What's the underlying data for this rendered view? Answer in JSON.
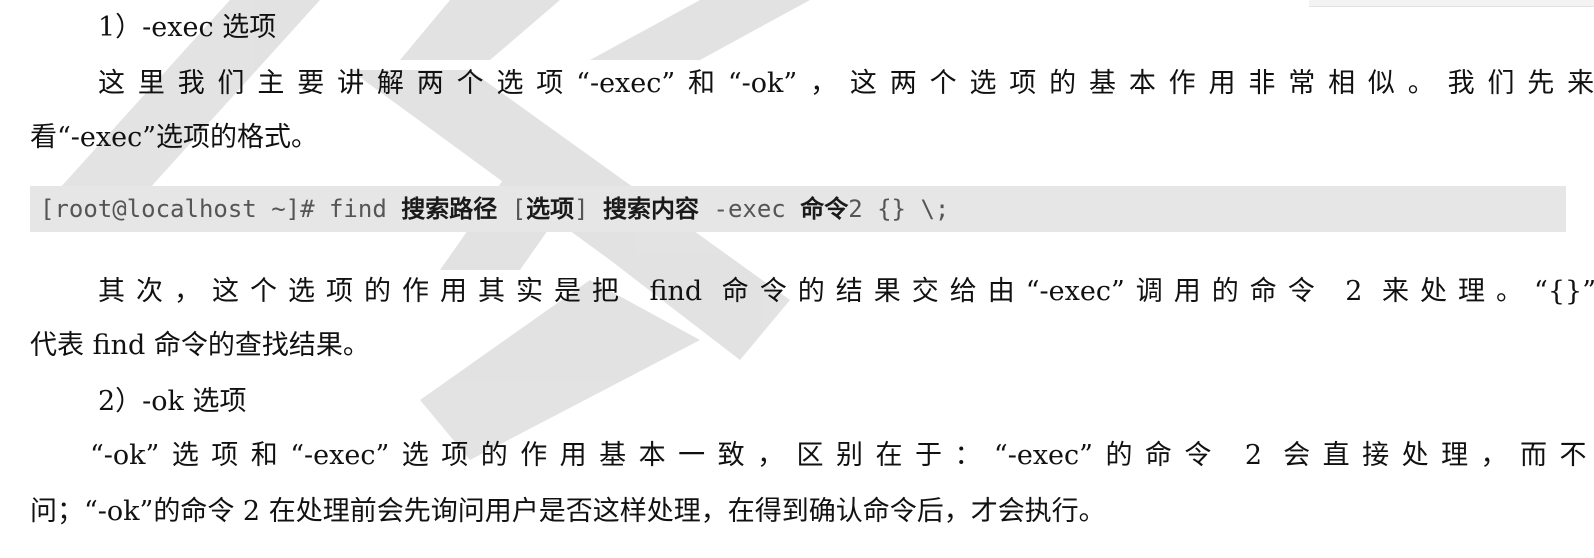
{
  "heading_exec": "1）-exec 选项",
  "para1": {
    "line1": "这里我们主要讲解两个选项“-exec”和“-ok”，这两个选项的基本作用非常相似。我们先来看",
    "line2": "看“-exec”选项的格式。"
  },
  "code": {
    "prompt": "[root@localhost ~]# find ",
    "part1": "搜索路径",
    "sep1": " [",
    "part2": "选项",
    "sep2": "] ",
    "part3": "搜索内容",
    "sep3": " -exec ",
    "part4": "命令",
    "tail": "2 {} \\;"
  },
  "para2": {
    "line1": "其次，这个选项的作用其实是把 find 命令的结果交给由“-exec”调用的命令 2 来处理。“{}”就",
    "line2": "代表 find 命令的查找结果。"
  },
  "heading_ok": "2）-ok 选项",
  "para3": {
    "line1": "“-ok”选项和“-exec”选项的作用基本一致，区别在于：“-exec”的命令 2 会直接处理，而不询",
    "line2": "问；“-ok”的命令 2 在处理前会先询问用户是否这样处理，在得到确认命令后，才会执行。"
  },
  "colors": {
    "text": "#111111",
    "code_bg": "#e6e6e6",
    "code_text": "#555555",
    "watermark": "#d9d9d9"
  }
}
